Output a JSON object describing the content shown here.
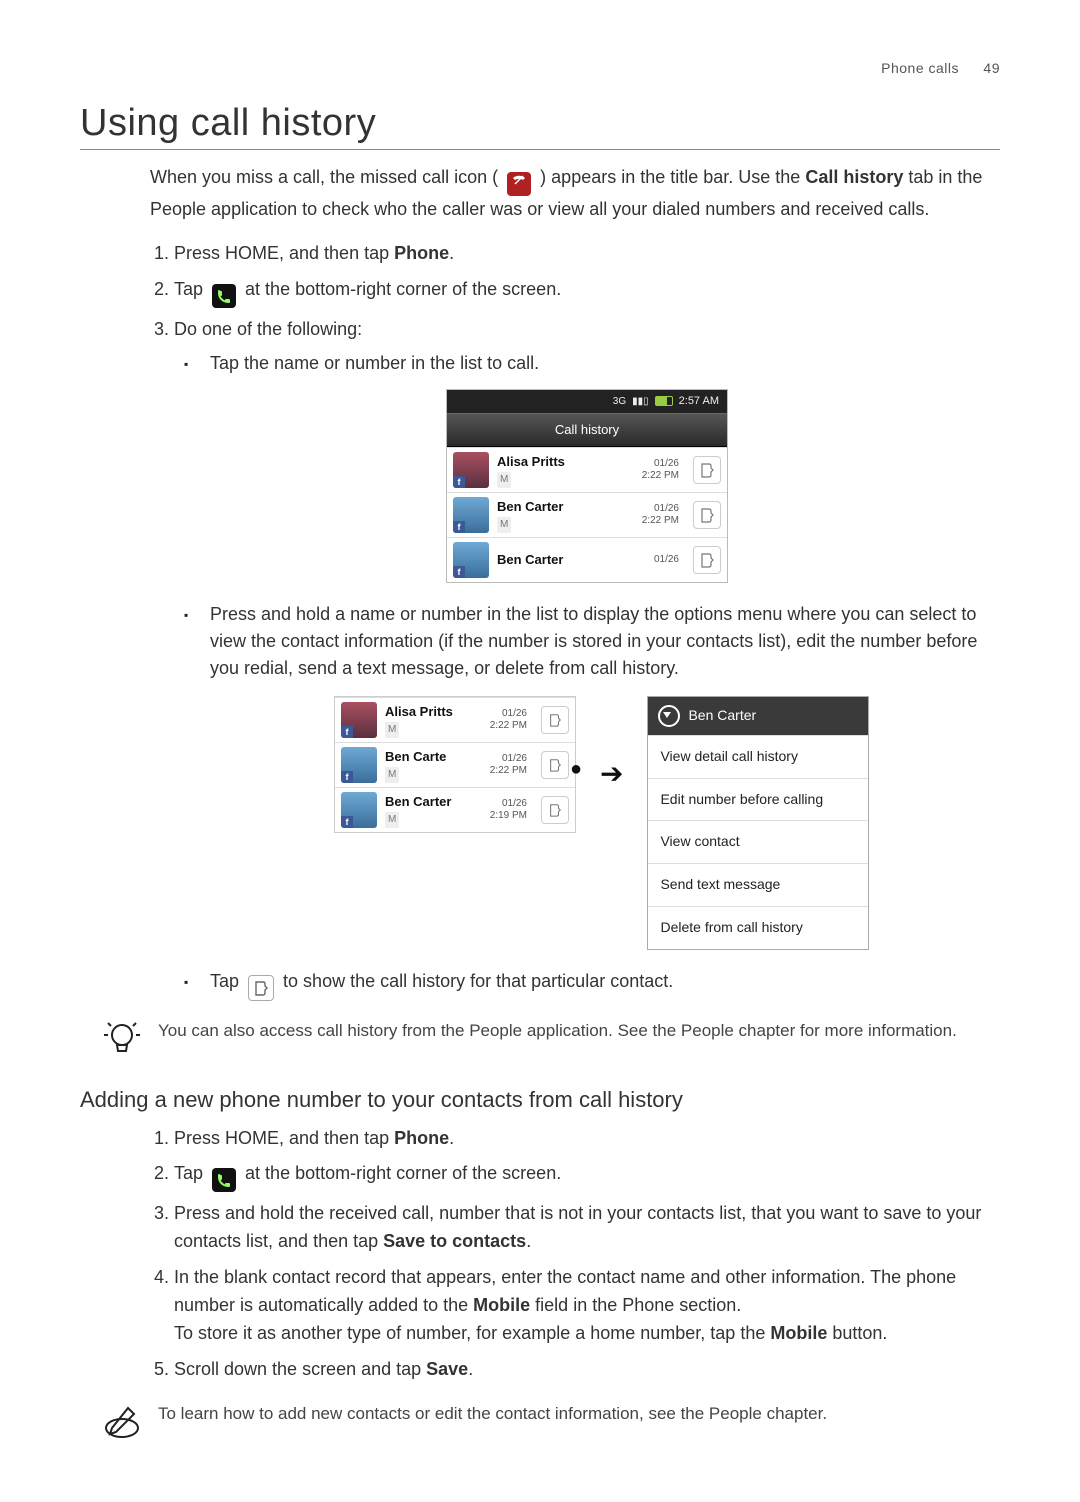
{
  "header": {
    "section": "Phone calls",
    "page": "49"
  },
  "title": "Using call history",
  "intro": {
    "part1": "When you miss a call, the missed call icon (",
    "part2": ") appears in the title bar. Use the ",
    "bold1": "Call history",
    "part3": " tab in the People application to check who the caller was or view all your dialed numbers and received calls."
  },
  "stepsA": {
    "s1a": "Press HOME, and then tap ",
    "s1b": "Phone",
    "s1c": ".",
    "s2a": "Tap ",
    "s2b": " at the bottom-right corner of the screen.",
    "s3": "Do one of the following:"
  },
  "bulletsA": {
    "b1": "Tap the name or number in the list to call.",
    "b2": "Press and hold a name or number in the list to display the options menu where you can select to view the contact information (if the number is stored in your contacts list), edit the number before you redial, send a text message, or delete from call history.",
    "b3a": "Tap ",
    "b3b": " to show the call history for that particular contact."
  },
  "tip1": "You can also access call history from the People application. See the People chapter for more information.",
  "subsection": "Adding a new phone number to your contacts from call history",
  "stepsB": {
    "s1a": "Press HOME, and then tap ",
    "s1b": "Phone",
    "s1c": ".",
    "s2a": "Tap ",
    "s2b": " at the bottom-right corner of the screen.",
    "s3a": "Press and hold the received call, number that is not in your contacts list, that you want to save to your contacts list, and then tap ",
    "s3b": "Save to contacts",
    "s3c": ".",
    "s4a": "In the blank contact record that appears, enter the contact name and other information. The phone number is automatically added to the ",
    "s4b": "Mobile",
    "s4c": " field in the Phone section.",
    "s4d": "To store it as another type of number, for example a home number, tap the ",
    "s4e": "Mobile",
    "s4f": " button.",
    "s5a": "Scroll down the screen and tap ",
    "s5b": "Save",
    "s5c": "."
  },
  "tip2": "To learn how to add new contacts or edit the contact information, see the People chapter.",
  "phoneWidget": {
    "status": {
      "net": "3G",
      "time": "2:57 AM"
    },
    "title": "Call history",
    "rows": [
      {
        "name": "Alisa Pritts",
        "sub": "M",
        "date": "01/26",
        "time": "2:22 PM",
        "avatar": "female"
      },
      {
        "name": "Ben  Carter",
        "sub": "M",
        "date": "01/26",
        "time": "2:22 PM",
        "avatar": "male"
      },
      {
        "name": "Ben  Carter",
        "sub": "",
        "date": "01/26",
        "time": "",
        "avatar": "male"
      }
    ]
  },
  "miniList": {
    "rows": [
      {
        "name": "Alisa Pritts",
        "sub": "M",
        "date": "01/26",
        "time": "2:22 PM",
        "avatar": "female"
      },
      {
        "name": "Ben  Carte",
        "sub": "M",
        "date": "01/26",
        "time": "2:22 PM",
        "avatar": "male"
      },
      {
        "name": "Ben  Carter",
        "sub": "M",
        "date": "01/26",
        "time": "2:19 PM",
        "avatar": "male"
      }
    ]
  },
  "ctxMenu": {
    "header": "Ben  Carter",
    "items": [
      "View detail call history",
      "Edit number before calling",
      "View contact",
      "Send text message",
      "Delete from call history"
    ]
  }
}
